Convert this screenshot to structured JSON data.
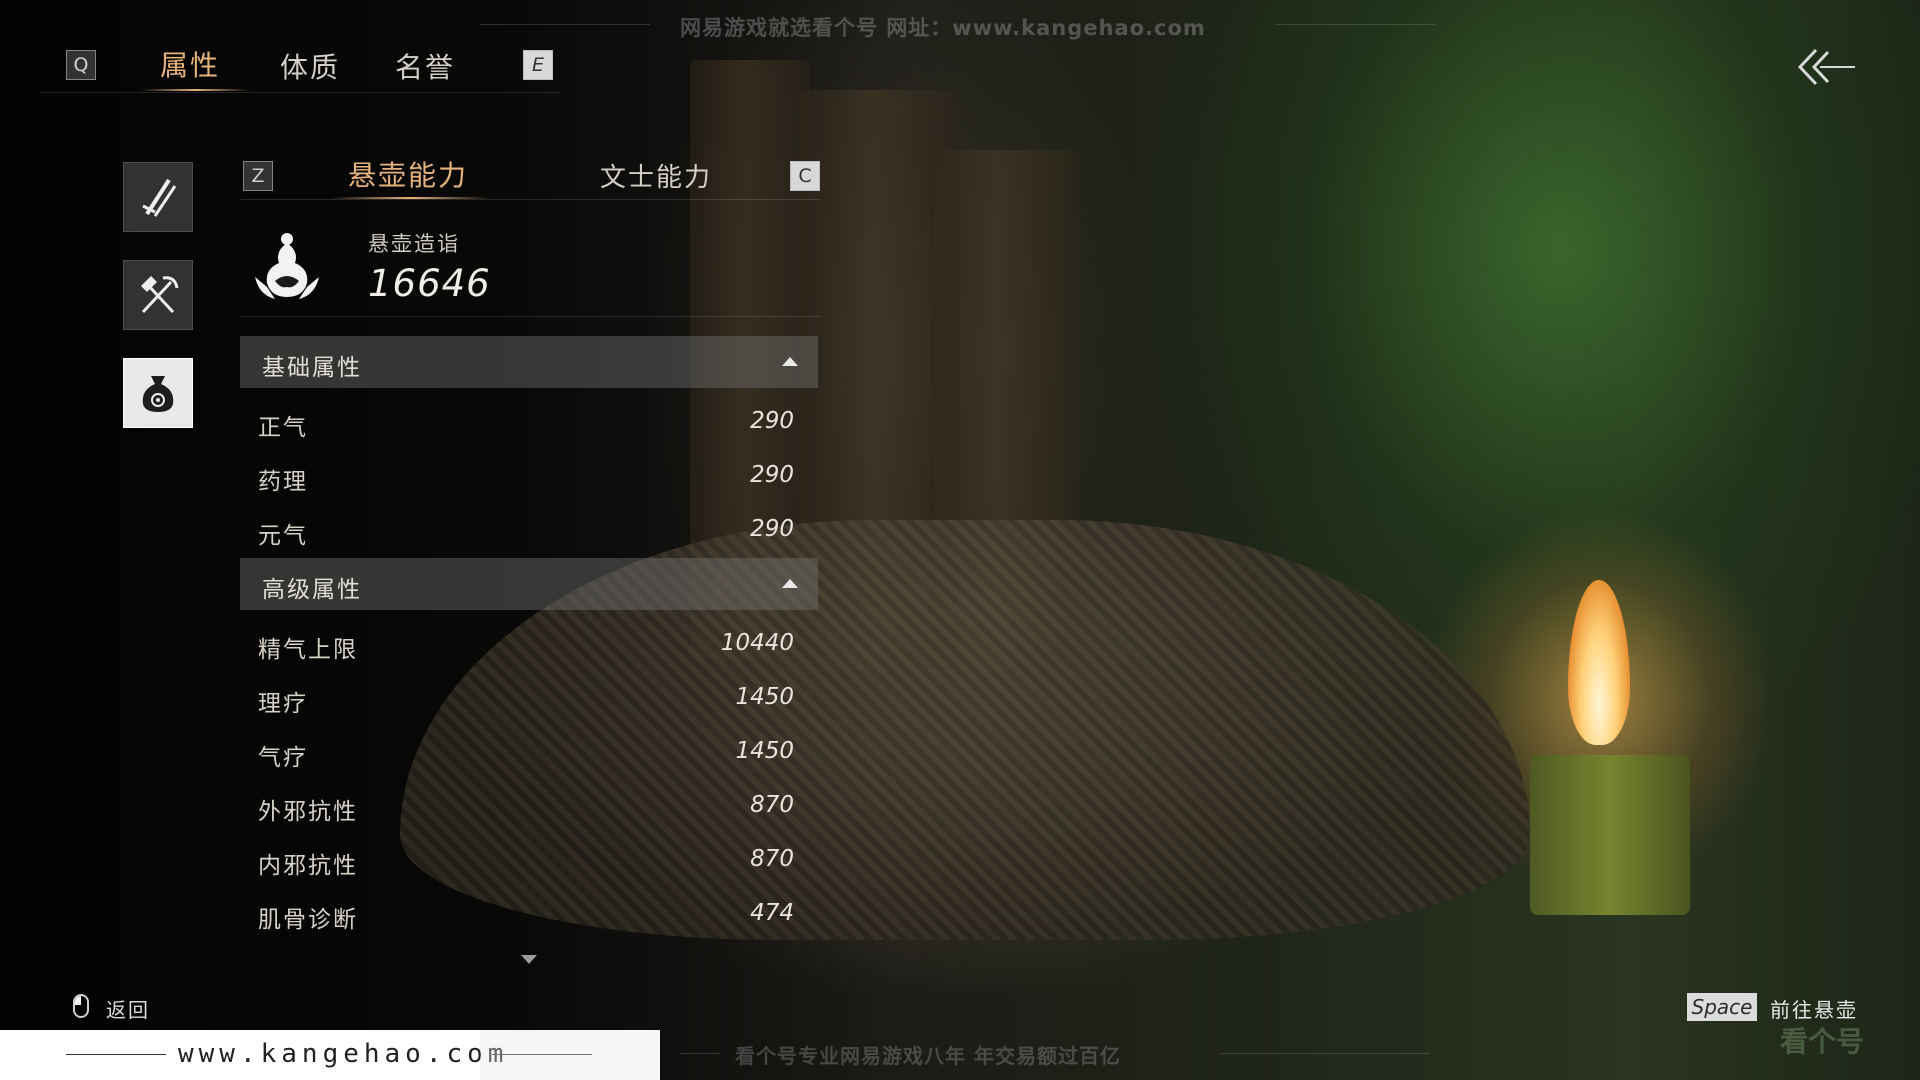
{
  "top_nav": {
    "left_key": "Q",
    "right_key": "E",
    "tabs": [
      "属性",
      "体质",
      "名誉"
    ]
  },
  "sub_nav": {
    "left_key": "Z",
    "right_key": "C",
    "tabs": [
      "悬壶能力",
      "文士能力"
    ]
  },
  "side_icons": [
    "sword-icon",
    "tools-icon",
    "medicine-bag-icon"
  ],
  "summary": {
    "label": "悬壶造诣",
    "value": "16646"
  },
  "sections": [
    {
      "title": "基础属性",
      "rows": [
        {
          "label": "正气",
          "value": "290"
        },
        {
          "label": "药理",
          "value": "290"
        },
        {
          "label": "元气",
          "value": "290"
        }
      ]
    },
    {
      "title": "高级属性",
      "rows": [
        {
          "label": "精气上限",
          "value": "10440"
        },
        {
          "label": "理疗",
          "value": "1450"
        },
        {
          "label": "气疗",
          "value": "1450"
        },
        {
          "label": "外邪抗性",
          "value": "870"
        },
        {
          "label": "内邪抗性",
          "value": "870"
        },
        {
          "label": "肌骨诊断",
          "value": "474"
        }
      ]
    }
  ],
  "hints": {
    "back_label": "返回",
    "space_key": "Space",
    "go_label": "前往悬壶"
  },
  "watermarks": {
    "top": "网易游戏就选看个号   网址：www.kangehao.com",
    "bottom": "看个号专业网易游戏八年   年交易额过百亿",
    "banner": "www.kangehao.com",
    "corner": "看个号"
  },
  "colors": {
    "accent": "#e7b37a",
    "panel": "#787878"
  }
}
